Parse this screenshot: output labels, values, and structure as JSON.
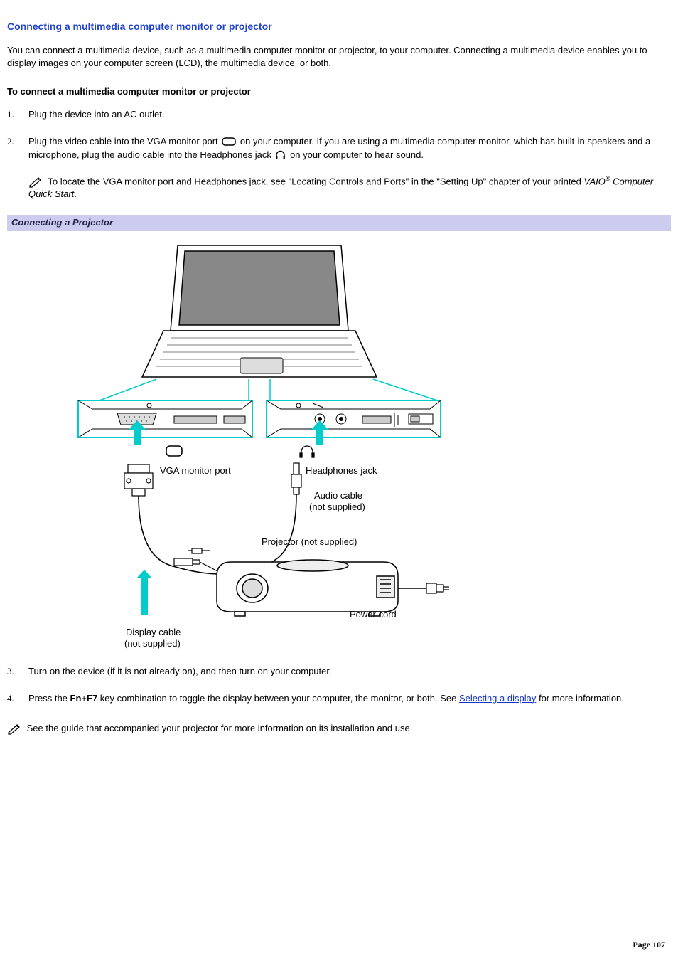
{
  "title": "Connecting a multimedia computer monitor or projector",
  "intro": "You can connect a multimedia device, such as a multimedia computer monitor or projector, to your computer. Connecting a multimedia device enables you to display images on your computer screen (LCD), the multimedia device, or both.",
  "sub_heading": "To connect a multimedia computer monitor or projector",
  "step1": "Plug the device into an AC outlet.",
  "step2_a": "Plug the video cable into the VGA monitor port ",
  "step2_b": " on your computer. If you are using a multimedia computer monitor, which has built-in speakers and a microphone, plug the audio cable into the Headphones jack ",
  "step2_c": " on your computer to hear sound.",
  "step2_note_a": "To locate the VGA monitor port and Headphones jack, see \"Locating Controls and Ports\" in the \"Setting Up\" chapter of your printed ",
  "step2_note_italic": "VAIO",
  "step2_note_reg": "®",
  "step2_note_italic2": " Computer Quick Start",
  "step2_note_end": ".",
  "figure_caption": "Connecting a Projector",
  "fig_labels": {
    "vga": "VGA monitor port",
    "headphones": "Headphones jack",
    "audio1": "Audio cable",
    "audio2": "(not supplied)",
    "projector": "Projector (not supplied)",
    "powercord": "Power cord",
    "display1": "Display cable",
    "display2": "(not supplied)"
  },
  "step3": "Turn on the device (if it is not already on), and then turn on your computer.",
  "step4_a": "Press the ",
  "step4_fn": "Fn",
  "step4_plus": "+",
  "step4_f7": "F7",
  "step4_b": " key combination to toggle the display between your computer, the monitor, or both. See ",
  "step4_link": "Selecting a display",
  "step4_c": " for more information.",
  "final_note": "See the guide that accompanied your projector for more information on its installation and use.",
  "page_label": "Page 107"
}
